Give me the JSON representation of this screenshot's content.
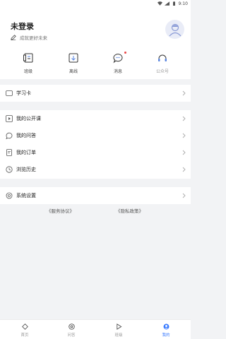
{
  "status_bar": {
    "time": "9:10"
  },
  "header": {
    "title": "未登录",
    "subtitle": "成就更好未来"
  },
  "quick_actions": [
    {
      "label": "班级",
      "icon": "class-icon"
    },
    {
      "label": "离线",
      "icon": "offline-download-icon"
    },
    {
      "label": "消息",
      "icon": "message-icon",
      "badge": true
    },
    {
      "label": "公众号",
      "icon": "headset-icon"
    }
  ],
  "menu": {
    "study_card": "学习卡",
    "my_public_courses": "我的公开课",
    "my_questions": "我的问答",
    "my_orders": "我的订单",
    "history": "浏览历史",
    "settings": "系统设置"
  },
  "links": {
    "service_agreement": "《服务协议》",
    "privacy_policy": "《隐私政策》"
  },
  "tabbar": [
    {
      "label": "首页",
      "icon": "home-diamond-icon",
      "active": false
    },
    {
      "label": "问答",
      "icon": "qa-target-icon",
      "active": false
    },
    {
      "label": "班级",
      "icon": "play-triangle-icon",
      "active": false
    },
    {
      "label": "我的",
      "icon": "profile-icon",
      "active": true
    }
  ],
  "colors": {
    "accent": "#3a7bff",
    "badge": "#e94545",
    "background": "#f2f3f5"
  }
}
